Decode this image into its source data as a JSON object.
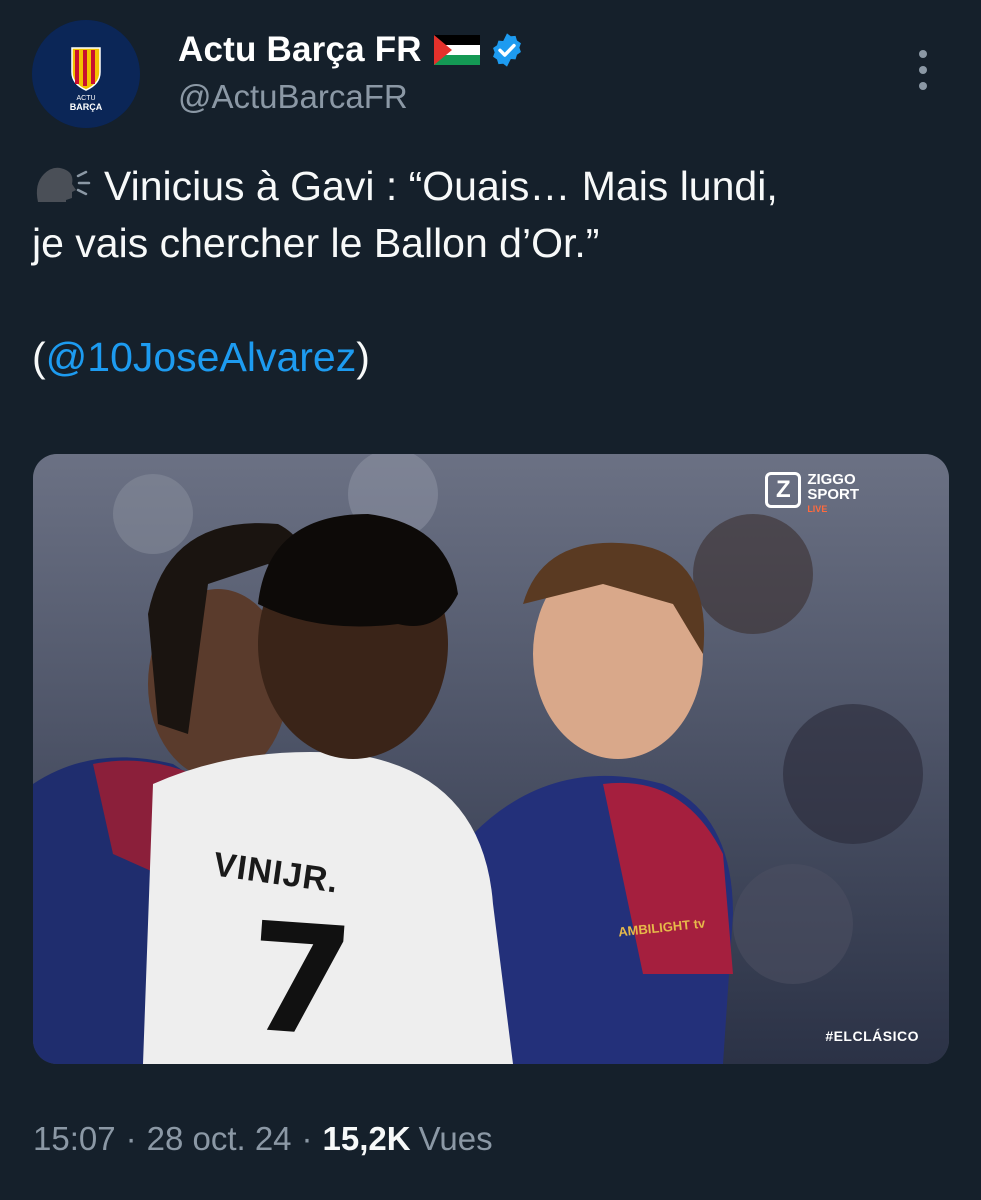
{
  "author": {
    "display_name": "Actu Barça FR",
    "handle": "@ActuBarcaFR",
    "flag_icon": "palestine-flag-icon",
    "verified_icon": "verified-badge-icon",
    "avatar_text_top": "ACTU",
    "avatar_text_bottom": "BARÇA"
  },
  "tweet": {
    "speaker_icon": "speaking-head-icon",
    "line1": "Vinicius à Gavi : “Ouais… Mais lundi,",
    "line2": "je vais chercher le Ballon d’Or.”",
    "mention_open": "(",
    "mention": "@10JoseAlvarez",
    "mention_close": ")"
  },
  "media": {
    "broadcaster_logo": "Z",
    "broadcaster_line1": "ZIGGO",
    "broadcaster_line2": "SPORT",
    "broadcaster_live": "LIVE",
    "hashtag": "#ELCLÁSICO",
    "jersey_name": "VINIJR.",
    "jersey_number": "7",
    "sponsor": "AMBILIGHT tv"
  },
  "meta": {
    "time": "15:07",
    "separator": "·",
    "date": "28 oct. 24",
    "views_count": "15,2K",
    "views_label": "Vues"
  },
  "colors": {
    "background": "#15202b",
    "text": "#f7f9f9",
    "secondary": "#8b98a5",
    "link": "#1d9bf0",
    "verified": "#1d9bf0"
  }
}
